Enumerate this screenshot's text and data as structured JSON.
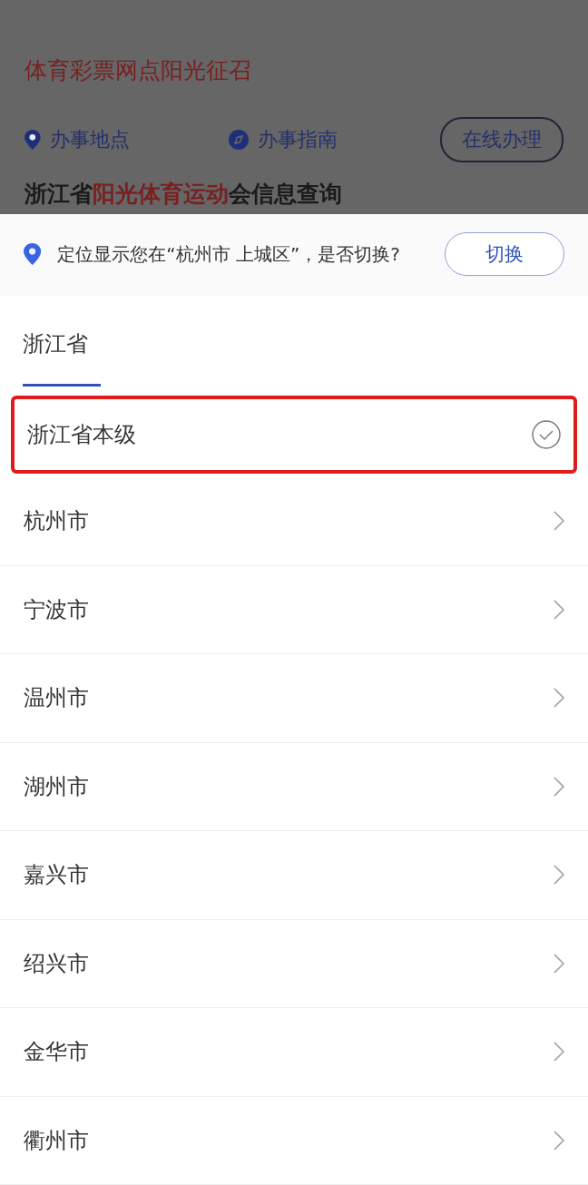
{
  "background": {
    "title": "体育彩票网点阳光征召",
    "links": [
      {
        "kind": "pin",
        "label": "办事地点"
      },
      {
        "kind": "compass",
        "label": "办事指南"
      }
    ],
    "action_button": "在线办理",
    "heading": [
      {
        "text": "浙江省",
        "highlight": false
      },
      {
        "text": "阳光体育运动",
        "highlight": true
      },
      {
        "text": "会信息查询",
        "highlight": false
      }
    ]
  },
  "location_prompt": {
    "message": "定位显示您在“杭州市 上城区”，是否切换?",
    "button": "切换"
  },
  "tabs": [
    {
      "label": "浙江省",
      "selected": true
    }
  ],
  "regions": [
    {
      "name": "浙江省本级",
      "selected": true
    },
    {
      "name": "杭州市",
      "selected": false
    },
    {
      "name": "宁波市",
      "selected": false
    },
    {
      "name": "温州市",
      "selected": false
    },
    {
      "name": "湖州市",
      "selected": false
    },
    {
      "name": "嘉兴市",
      "selected": false
    },
    {
      "name": "绍兴市",
      "selected": false
    },
    {
      "name": "金华市",
      "selected": false
    },
    {
      "name": "衢州市",
      "selected": false
    }
  ]
}
